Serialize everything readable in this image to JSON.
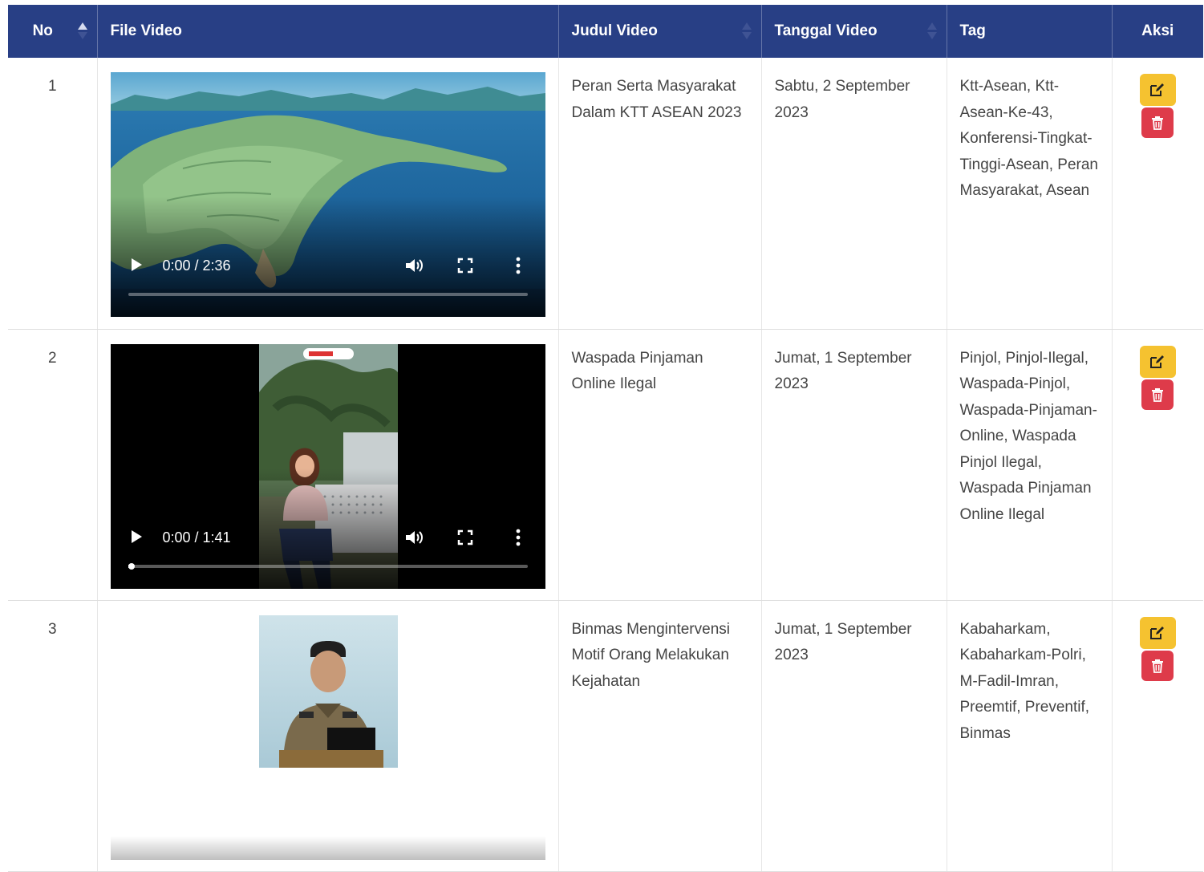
{
  "table": {
    "headers": {
      "no": "No",
      "file": "File Video",
      "judul": "Judul Video",
      "tanggal": "Tanggal Video",
      "tag": "Tag",
      "aksi": "Aksi"
    },
    "sort": {
      "column": "No",
      "direction": "asc"
    },
    "rows": [
      {
        "no": "1",
        "video": {
          "time": "0:00 / 2:36",
          "progress": 0.0,
          "thumbnail": "aerial-island-illustration"
        },
        "judul": "Peran Serta Masyarakat Dalam KTT ASEAN 2023",
        "tanggal": "Sabtu, 2 September 2023",
        "tag": "Ktt-Asean, Ktt-Asean-Ke-43, Konferensi-Tingkat-Tinggi-Asean, Peran Masyarakat, Asean"
      },
      {
        "no": "2",
        "video": {
          "time": "0:00 / 1:41",
          "progress": 0.01,
          "thumbnail": "woman-on-bench-portrait"
        },
        "judul": "Waspada Pinjaman Online Ilegal",
        "tanggal": "Jumat, 1 September 2023",
        "tag": "Pinjol, Pinjol-Ilegal, Waspada-Pinjol, Waspada-Pinjaman-Online, Waspada Pinjol Ilegal, Waspada Pinjaman Online Ilegal"
      },
      {
        "no": "3",
        "video": {
          "time": "",
          "progress": 0.0,
          "thumbnail": "police-officer-portrait"
        },
        "judul": "Binmas Mengintervensi Motif Orang Melakukan Kejahatan",
        "tanggal": "Jumat, 1 September 2023",
        "tag": "Kabaharkam, Kabaharkam-Polri, M-Fadil-Imran, Preemtif, Preventif, Binmas"
      }
    ]
  },
  "icons": {
    "edit": "edit-icon",
    "delete": "trash-icon",
    "play": "play-icon",
    "volume": "volume-icon",
    "fullscreen": "fullscreen-icon",
    "more": "more-vertical-icon"
  },
  "colors": {
    "header_bg": "#283f85",
    "edit_button": "#f5c230",
    "delete_button": "#de3b4a"
  }
}
